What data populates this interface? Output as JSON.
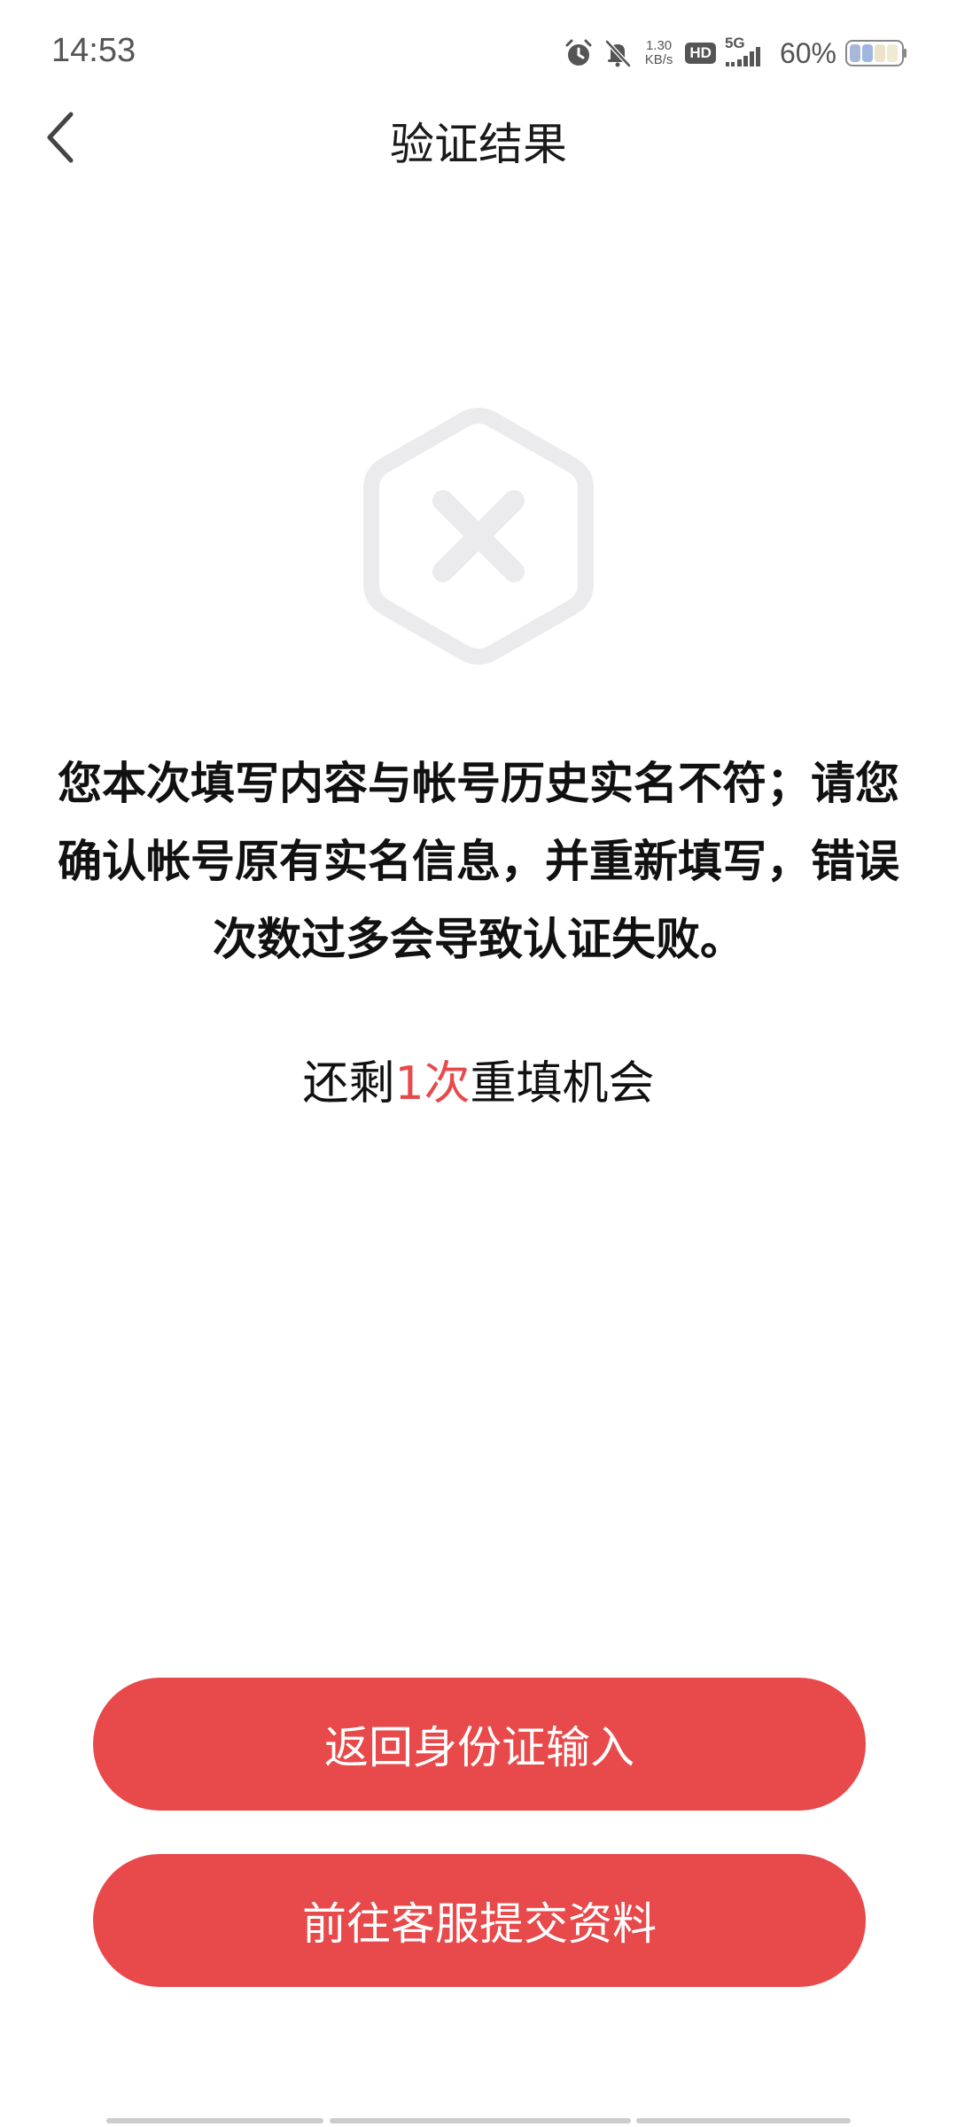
{
  "status_bar": {
    "time": "14:53",
    "net_speed_value": "1.30",
    "net_speed_unit": "KB/s",
    "hd_label": "HD",
    "network_label": "5G",
    "battery_percent": "60%",
    "icons": [
      "alarm-icon",
      "mute-icon",
      "hd-icon",
      "signal-icon",
      "battery-icon"
    ]
  },
  "header": {
    "title": "验证结果",
    "back_icon": "chevron-left-icon"
  },
  "result": {
    "icon": "failure-x-hexagon-icon",
    "message": "您本次填写内容与帐号历史实名不符；请您确认帐号原有实名信息，并重新填写，错误次数过多会导致认证失败。",
    "remaining_prefix": "还剩",
    "remaining_count": "1次",
    "remaining_suffix": "重填机会"
  },
  "actions": {
    "back_to_id_input": "返回身份证输入",
    "contact_support": "前往客服提交资料"
  },
  "colors": {
    "accent": "#e8494a",
    "icon_gray": "#ebebed",
    "text_primary": "#111111",
    "status_text": "#555555"
  }
}
